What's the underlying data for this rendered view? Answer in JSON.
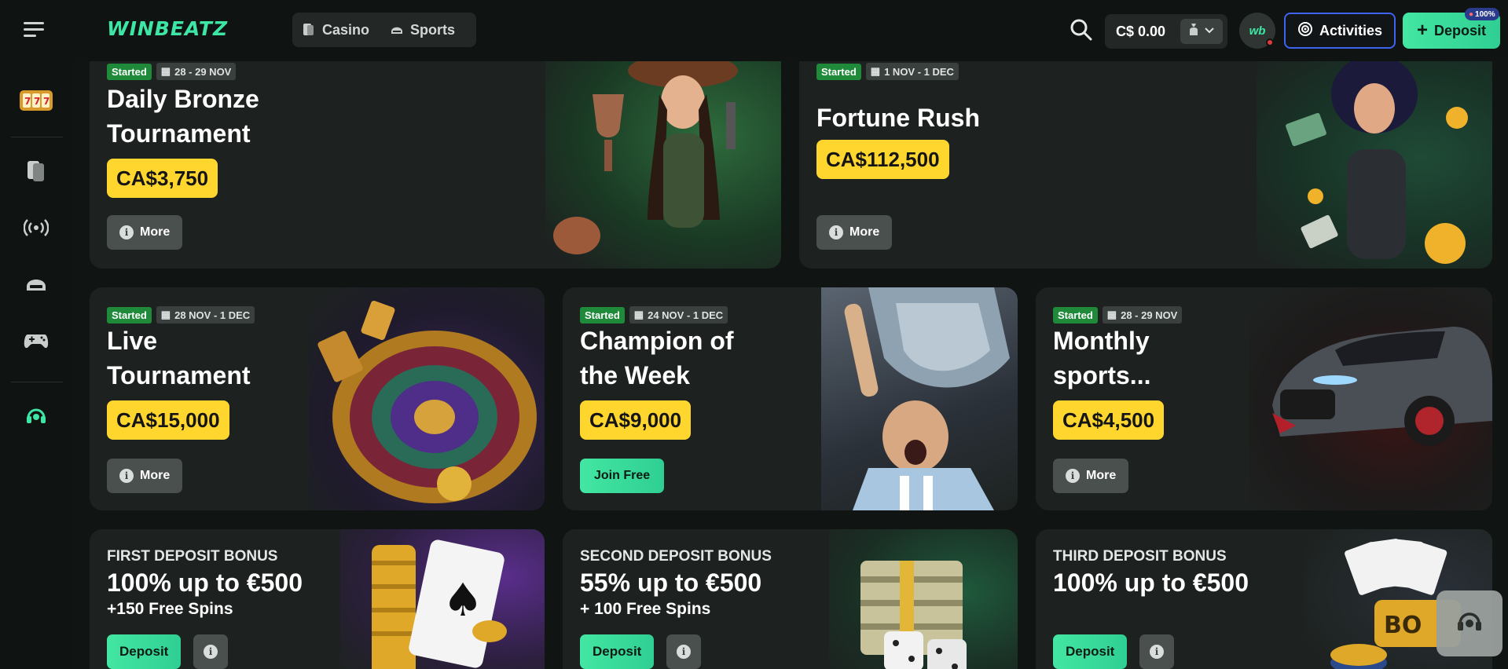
{
  "header": {
    "logo": "WINBEATZ",
    "nav": [
      {
        "label": "Casino",
        "icon": "casino-card-icon"
      },
      {
        "label": "Sports",
        "icon": "sports-helmet-icon"
      }
    ],
    "balance": "C$ 0.00",
    "avatar_initials": "wb",
    "activities_label": "Activities",
    "deposit_label": "Deposit",
    "badge_label": "100%",
    "accent": "#3ee6a6"
  },
  "sidebar": {
    "items": [
      {
        "name": "slots-icon"
      },
      {
        "name": "casino-card-icon"
      },
      {
        "name": "live-broadcast-icon"
      },
      {
        "name": "sports-helmet-icon"
      },
      {
        "name": "gamepad-icon"
      },
      {
        "name": "support-headset-icon"
      }
    ]
  },
  "tournaments": [
    {
      "status": "Started",
      "dates": "28 - 29 NOV",
      "title_line1": "Daily Bronze",
      "title_line2": "Tournament",
      "prize": "CA$3,750",
      "action": "More"
    },
    {
      "status": "Started",
      "dates": "1 NOV - 1 DEC",
      "title_line1": "Fortune Rush",
      "title_line2": "",
      "prize": "CA$112,500",
      "action": "More"
    },
    {
      "status": "Started",
      "dates": "28 NOV - 1 DEC",
      "title_line1": "Live",
      "title_line2": "Tournament",
      "prize": "CA$15,000",
      "action": "More"
    },
    {
      "status": "Started",
      "dates": "24 NOV - 1 DEC",
      "title_line1": "Champion of",
      "title_line2": "the Week",
      "prize": "CA$9,000",
      "action": "Join Free"
    },
    {
      "status": "Started",
      "dates": "28 - 29 NOV",
      "title_line1": "Monthly",
      "title_line2": "sports...",
      "prize": "CA$4,500",
      "action": "More"
    }
  ],
  "bonuses": [
    {
      "label": "FIRST DEPOSIT BONUS",
      "main": "100% up to €500",
      "sub": "+150 Free Spins",
      "action": "Deposit"
    },
    {
      "label": "SECOND DEPOSIT BONUS",
      "main": "55% up to €500",
      "sub": "+ 100 Free Spins",
      "action": "Deposit"
    },
    {
      "label": "THIRD DEPOSIT BONUS",
      "main": "100% up to €500",
      "sub": "",
      "action": "Deposit"
    }
  ]
}
